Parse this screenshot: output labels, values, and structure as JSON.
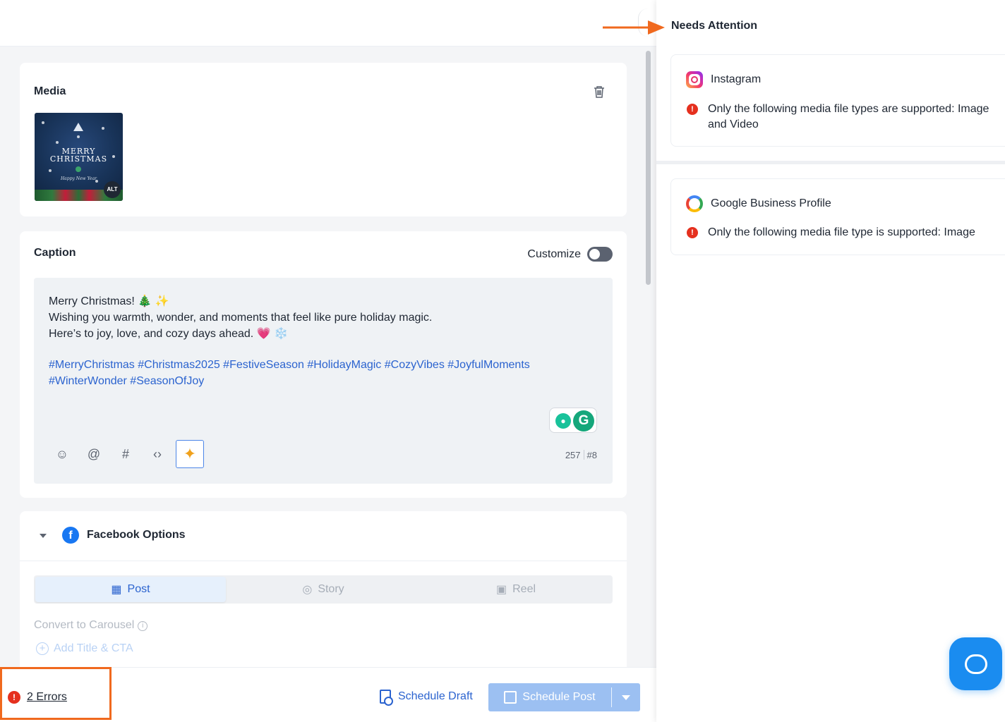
{
  "media": {
    "title": "Media",
    "thumbnail_text": "MERRY CHRISTMAS",
    "thumbnail_subtext": "Happy New Year",
    "alt_badge": "ALT"
  },
  "caption": {
    "title": "Caption",
    "customize_label": "Customize",
    "lines": [
      "Merry Christmas! 🎄 ✨",
      "Wishing you warmth, wonder, and moments that feel like pure holiday magic.",
      "Here’s to joy, love, and cozy days ahead. 💗 ❄️"
    ],
    "hashtag_lines": [
      "#MerryChristmas #Christmas2025 #FestiveSeason #HolidayMagic #CozyVibes #JoyfulMoments",
      "#WinterWonder #SeasonOfJoy"
    ],
    "char_count": "257",
    "hashtag_count": "#8"
  },
  "facebook": {
    "title": "Facebook Options",
    "tabs": [
      {
        "label": "Post",
        "active": true
      },
      {
        "label": "Story",
        "active": false
      },
      {
        "label": "Reel",
        "active": false
      }
    ],
    "convert_label": "Convert to Carousel",
    "add_cta_label": "Add Title & CTA"
  },
  "footer": {
    "errors_label": "2 Errors",
    "schedule_draft_label": "Schedule Draft",
    "schedule_post_label": "Schedule Post"
  },
  "panel": {
    "title": "Needs Attention",
    "issues": [
      {
        "platform": "Instagram",
        "message": "Only the following media file types are supported: Image and Video"
      },
      {
        "platform": "Google Business Profile",
        "message": "Only the following media file type is supported: Image"
      }
    ]
  },
  "colors": {
    "accent": "#2b63cf",
    "error": "#e5301e",
    "highlight": "#f0691e",
    "schedule_button": "#9cc0f2",
    "chat": "#1a8cf0"
  },
  "icons": [
    "trash-icon",
    "emoji-icon",
    "mention-icon",
    "hashtag-icon",
    "code-icon",
    "ai-sparkle-icon",
    "grammarly-icon",
    "facebook-icon",
    "instagram-icon",
    "google-icon",
    "error-icon",
    "chat-icon"
  ]
}
